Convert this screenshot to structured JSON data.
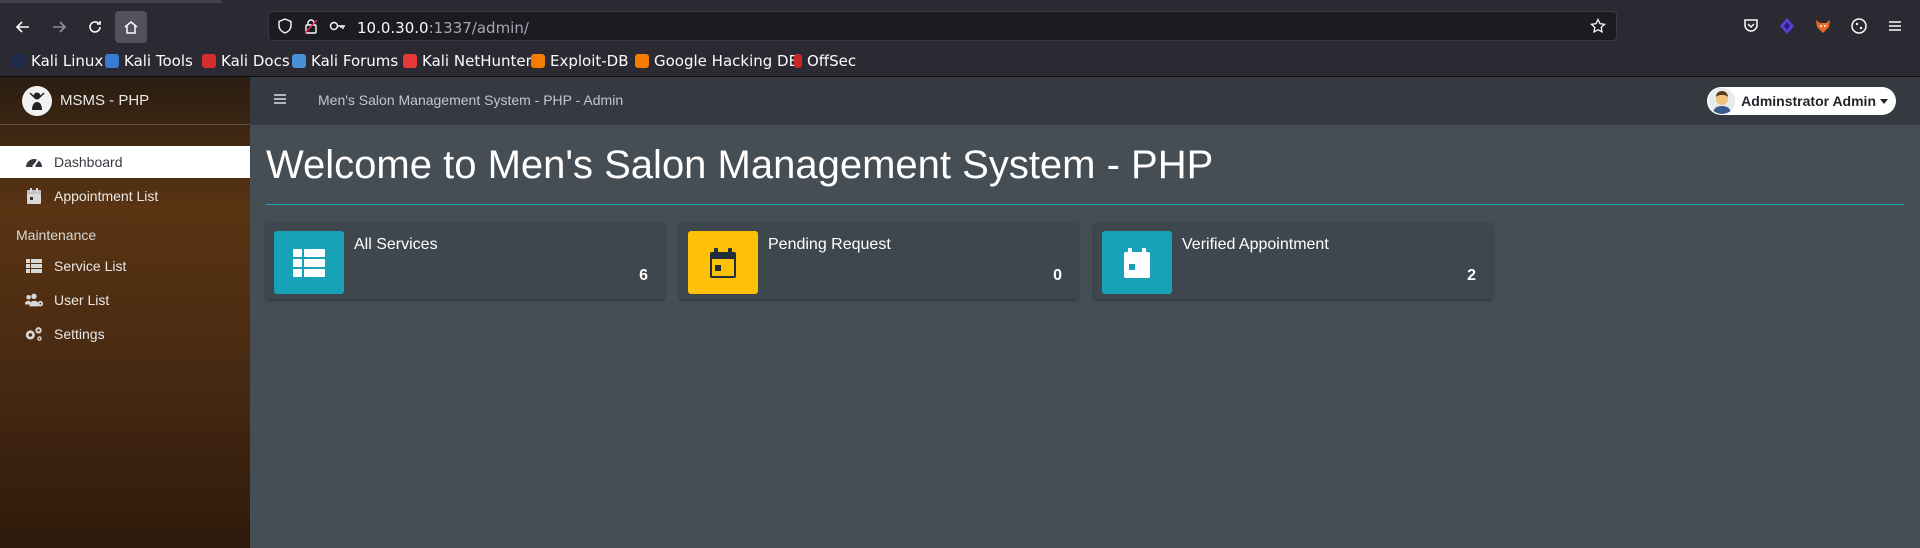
{
  "browser": {
    "url_host": "10.0.30.0",
    "url_rest": ":1337/admin/",
    "bookmarks": [
      {
        "label": "Kali Linux",
        "color": "#367bf0"
      },
      {
        "label": "Kali Tools",
        "color": "#3a7bd5"
      },
      {
        "label": "Kali Docs",
        "color": "#d32f2f"
      },
      {
        "label": "Kali Forums",
        "color": "#4a90d9"
      },
      {
        "label": "Kali NetHunter",
        "color": "#e53935"
      },
      {
        "label": "Exploit-DB",
        "color": "#f57c00"
      },
      {
        "label": "Google Hacking DB",
        "color": "#f57c00"
      },
      {
        "label": "OffSec",
        "color": "#c62828"
      }
    ]
  },
  "sidebar": {
    "brand": "MSMS - PHP",
    "items": [
      {
        "label": "Dashboard",
        "icon": "tachometer-icon"
      },
      {
        "label": "Appointment List",
        "icon": "calendar-icon"
      }
    ],
    "section_header": "Maintenance",
    "maintenance_items": [
      {
        "label": "Service List",
        "icon": "list-icon"
      },
      {
        "label": "User List",
        "icon": "users-cog-icon"
      },
      {
        "label": "Settings",
        "icon": "cogs-icon"
      }
    ]
  },
  "header": {
    "title": "Men's Salon Management System - PHP - Admin",
    "user_name": "Adminstrator Admin"
  },
  "main": {
    "welcome": "Welcome to Men's Salon Management System - PHP",
    "cards": [
      {
        "label": "All Services",
        "count": "6",
        "color": "#17a2b8",
        "icon": "th-list-icon"
      },
      {
        "label": "Pending Request",
        "count": "0",
        "color": "#ffc107",
        "icon": "calendar-pending-icon"
      },
      {
        "label": "Verified Appointment",
        "count": "2",
        "color": "#17a2b8",
        "icon": "calendar-check-icon"
      }
    ]
  }
}
